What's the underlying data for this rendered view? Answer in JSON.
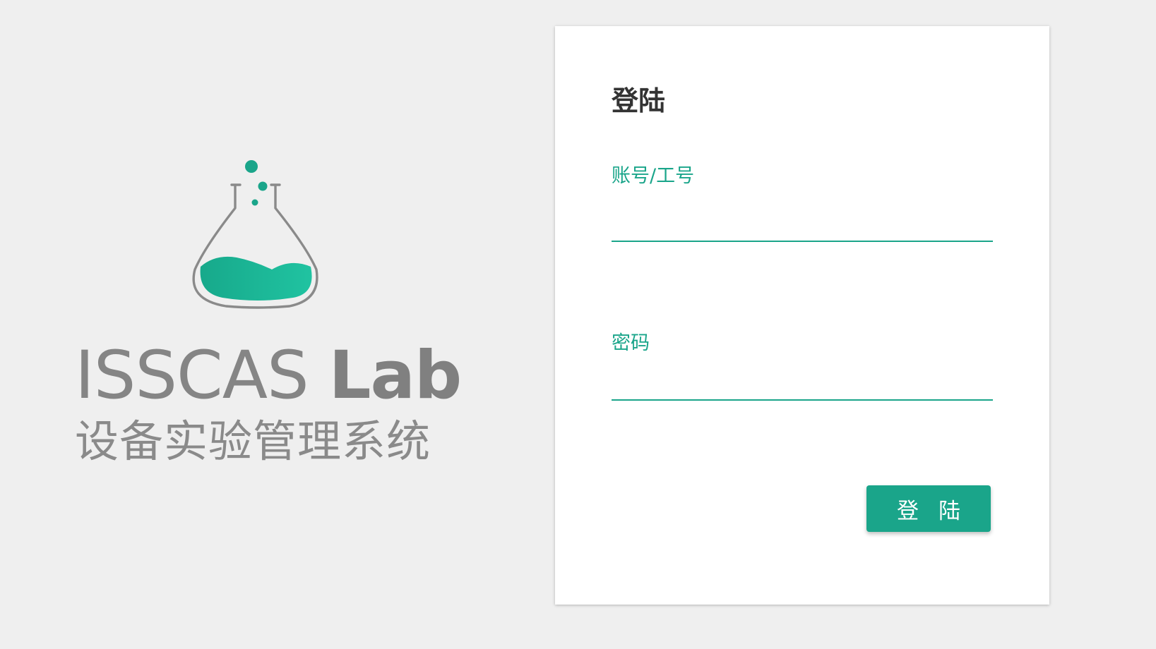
{
  "brand": {
    "logo_icon": "flask-icon",
    "title_thin": "ISSCAS",
    "title_bold": "Lab",
    "subtitle": "设备实验管理系统"
  },
  "login": {
    "title": "登陆",
    "account_label": "账号/工号",
    "account_value": "",
    "password_label": "密码",
    "password_value": "",
    "submit_label": "登陆"
  },
  "colors": {
    "accent": "#1aa58a",
    "background": "#efefef",
    "card": "#ffffff",
    "brand_text": "#808080"
  }
}
